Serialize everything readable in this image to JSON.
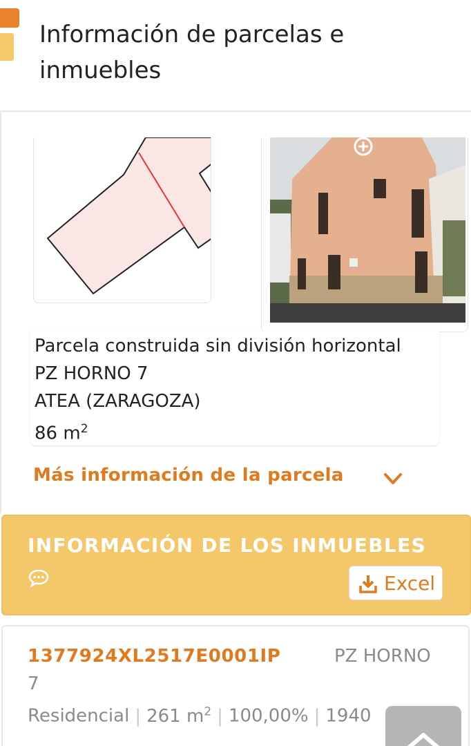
{
  "header": {
    "title": "Información de parcelas e inmuebles"
  },
  "parcel": {
    "description_lines": [
      "Parcela construida sin división horizontal",
      "PZ HORNO 7",
      "ATEA (ZARAGOZA)"
    ],
    "area_value": "86 m",
    "area_exp": "2",
    "more_info_label": "Más información de la parcela"
  },
  "inmuebles": {
    "section_title": "INFORMACIÓN DE LOS INMUEBLES",
    "excel_label": "Excel",
    "items": [
      {
        "ref": "1377924XL2517E0001IP",
        "address_part1": "PZ HORNO",
        "address_part2": "7",
        "use": "Residencial",
        "surface_value": "261 m",
        "surface_exp": "2",
        "participation": "100,00%",
        "year": "1940"
      }
    ]
  },
  "colors": {
    "accent_orange": "#e07a1f",
    "section_yellow": "#f4c76b",
    "logo_orange": "#e8832c",
    "logo_yellow": "#f3c96a"
  },
  "icons": [
    "zoom-icon",
    "chevron-down-icon",
    "chat-icon",
    "download-icon",
    "chevron-up-icon"
  ]
}
